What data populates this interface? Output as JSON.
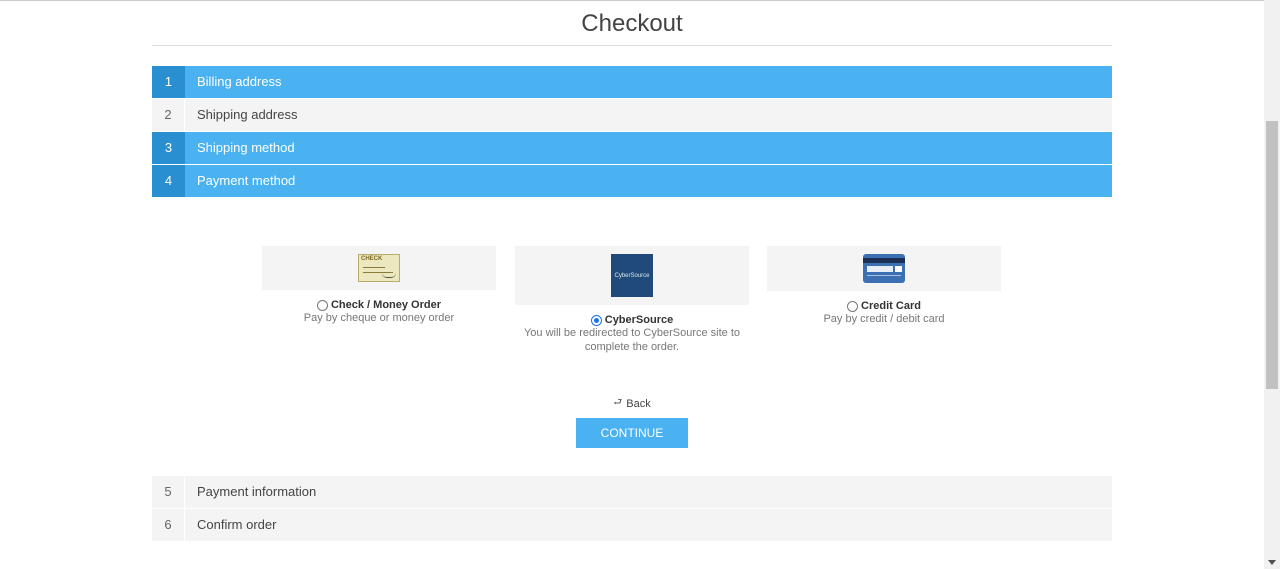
{
  "page": {
    "title": "Checkout"
  },
  "steps_top": [
    {
      "num": "1",
      "label": "Billing address",
      "state": "active"
    },
    {
      "num": "2",
      "label": "Shipping address",
      "state": "inactive"
    },
    {
      "num": "3",
      "label": "Shipping method",
      "state": "active"
    },
    {
      "num": "4",
      "label": "Payment method",
      "state": "active"
    }
  ],
  "payment_methods": [
    {
      "name": "Check / Money Order",
      "description": "Pay by cheque or money order",
      "selected": false,
      "icon": "check-icon",
      "image_text": "CHECK"
    },
    {
      "name": "CyberSource",
      "description": "You will be redirected to CyberSource site to complete the order.",
      "selected": true,
      "icon": "cybersource-logo",
      "image_text": "CyberSource"
    },
    {
      "name": "Credit Card",
      "description": "Pay by credit / debit card",
      "selected": false,
      "icon": "credit-card-icon"
    }
  ],
  "actions": {
    "back_label": "Back",
    "continue_label": "CONTINUE"
  },
  "steps_bottom": [
    {
      "num": "5",
      "label": "Payment information",
      "state": "inactive"
    },
    {
      "num": "6",
      "label": "Confirm order",
      "state": "inactive"
    }
  ],
  "colors": {
    "accent": "#4ab2f1",
    "accent_dark": "#2a8fd1",
    "inactive_bg": "#f4f4f4"
  }
}
